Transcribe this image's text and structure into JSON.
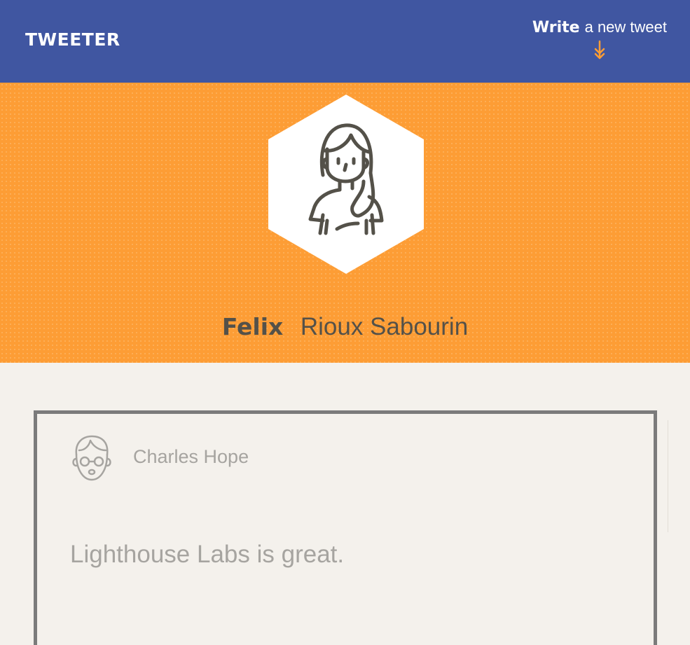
{
  "nav": {
    "brand": "TWEETER",
    "compose_strong": "Write",
    "compose_rest": "a new tweet",
    "compose_icon": "double-chevron-down-icon",
    "background": "#4056a1",
    "accent": "#fd9d35"
  },
  "profile": {
    "first_name": "Felix",
    "last_name": "Rioux Sabourin",
    "avatar_icon": "woman-avatar-icon",
    "hero_color": "#fd9d35"
  },
  "tweets": [
    {
      "avatar_icon": "man-with-glasses-avatar-icon",
      "user_name": "Charles Hope",
      "content": "Lighthouse Labs is great."
    }
  ]
}
